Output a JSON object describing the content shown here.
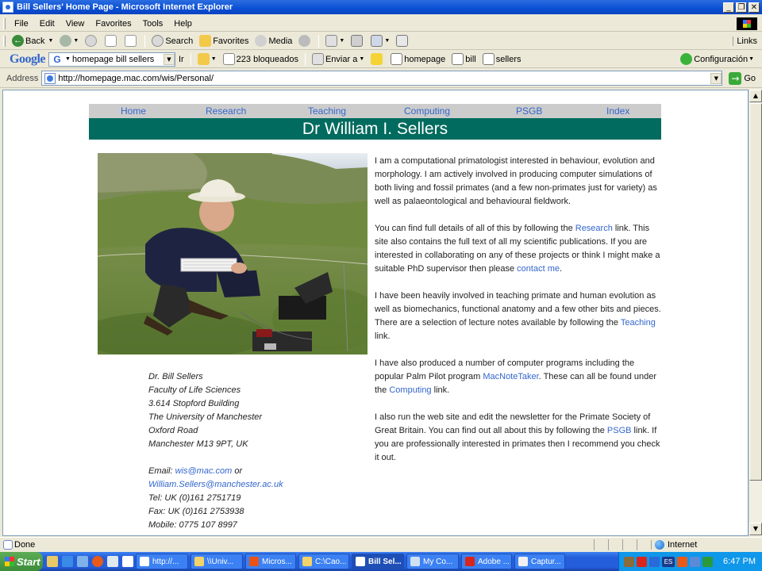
{
  "window": {
    "title": "Bill Sellers' Home Page - Microsoft Internet Explorer",
    "min": "_",
    "max": "❐",
    "close": "✕"
  },
  "menu": [
    "File",
    "Edit",
    "View",
    "Favorites",
    "Tools",
    "Help"
  ],
  "toolbar": {
    "back": "Back",
    "search": "Search",
    "favorites": "Favorites",
    "media": "Media",
    "links": "Links"
  },
  "google": {
    "logo": "Google",
    "query": "homepage bill sellers",
    "ir": "Ir",
    "blocked": "223 bloqueados",
    "send": "Enviar a",
    "words": [
      "homepage",
      "bill",
      "sellers"
    ],
    "config": "Configuración"
  },
  "address": {
    "label": "Address",
    "url": "http://homepage.mac.com/wis/Personal/",
    "go": "Go"
  },
  "page": {
    "nav": [
      "Home",
      "Research",
      "Teaching",
      "Computing",
      "PSGB",
      "Index"
    ],
    "banner": "Dr William I. Sellers",
    "contact": {
      "lines": [
        "Dr. Bill Sellers",
        "Faculty of Life Sciences",
        "3.614 Stopford Building",
        "The University of Manchester",
        "Oxford Road",
        "Manchester M13 9PT, UK"
      ],
      "email_prefix": "Email: ",
      "email1": "wis@mac.com",
      "email_or": " or",
      "email2": "William.Sellers@manchester.ac.uk",
      "tel": "Tel: UK (0)161 2751719",
      "fax": "Fax: UK (0)161 2753938",
      "mobile": "Mobile: 0775 107 8997"
    },
    "bio": {
      "p1": "I am a computational primatologist interested in behaviour, evolution and morphology. I am actively involved in producing computer simulations of both living and fossil primates (and a few non-primates just for variety) as well as palaeontological and behavioural fieldwork.",
      "p2a": "You can find full details of all of this by following the ",
      "p2link": "Research",
      "p2b": " link. This site also contains the full text of all my scientific publications. If you are interested in collaborating on any of these projects or think I might make a suitable PhD supervisor then please ",
      "p2link2": "contact me",
      "p2c": ".",
      "p3a": "I have been heavily involved in teaching primate and human evolution as well as biomechanics, functional anatomy and a few other bits and pieces. There are a selection of lecture notes available by following the ",
      "p3link": "Teaching",
      "p3b": " link.",
      "p4a": "I have also produced a number of computer programs including the popular Palm Pilot program ",
      "p4link": "MacNoteTaker",
      "p4b": ". These can all be found under the ",
      "p4link2": "Computing",
      "p4c": " link.",
      "p5a": "I also run the web site and edit the newsletter for the Primate Society of Great Britain. You can find out all about this by following the ",
      "p5link": "PSGB",
      "p5b": " link. If you are professionally interested in primates then I recommend you check it out."
    }
  },
  "status": {
    "text": "Done",
    "zone": "Internet"
  },
  "taskbar": {
    "start": "Start",
    "tasks": [
      "http://...",
      "\\\\Univ...",
      "Micros...",
      "C:\\Cao...",
      "Bill Sel...",
      "My Co...",
      "Adobe ...",
      "Captur..."
    ],
    "tray_lang": "ES",
    "clock": "6:47 PM"
  },
  "colors": {
    "banner": "#006b5e",
    "link": "#3366cc",
    "nav_bg": "#cccccc"
  }
}
